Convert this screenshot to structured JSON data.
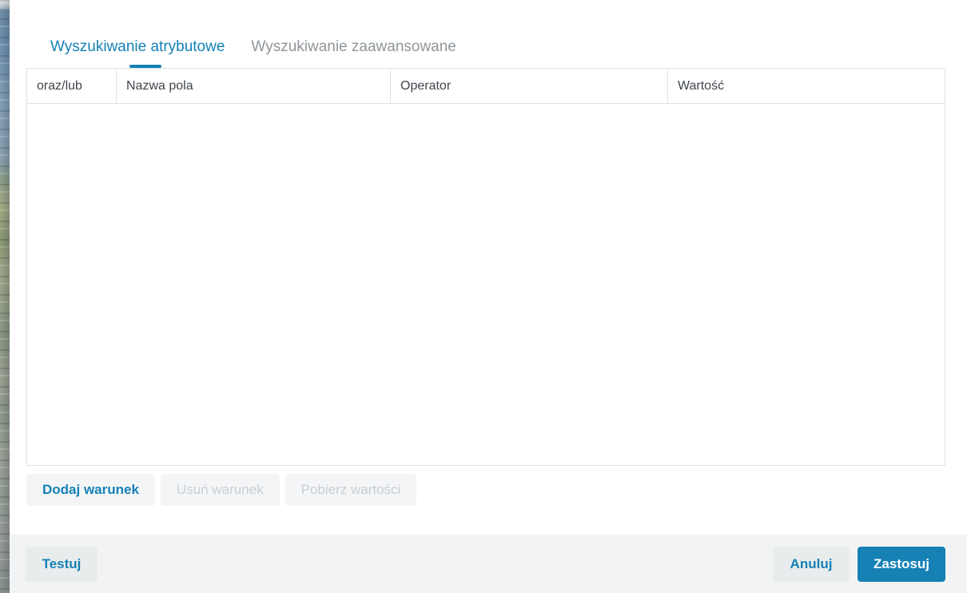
{
  "dialog": {
    "tabs": [
      {
        "label": "Wyszukiwanie atrybutowe",
        "active": true
      },
      {
        "label": "Wyszukiwanie zaawansowane",
        "active": false
      }
    ],
    "table": {
      "columns": [
        "oraz/lub",
        "Nazwa pola",
        "Operator",
        "Wartość"
      ],
      "rows": []
    },
    "toolbar": {
      "add_condition": "Dodaj warunek",
      "remove_condition": "Usuń warunek",
      "fetch_values": "Pobierz wartości"
    },
    "footer": {
      "test": "Testuj",
      "cancel": "Anuluj",
      "apply": "Zastosuj"
    }
  },
  "colors": {
    "accent": "#1581b5",
    "inactive_tab": "#8f969b",
    "header_text": "#40464d",
    "border": "#dee2e6",
    "disabled_text": "#c9ced3",
    "footer_bg": "#f2f3f4",
    "button_bg": "#f4f5f6",
    "footer_button_bg": "#e9eced"
  }
}
